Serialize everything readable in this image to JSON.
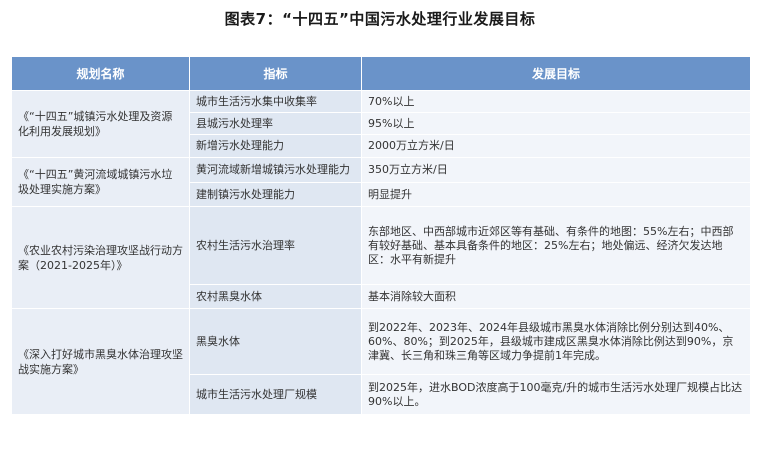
{
  "title": "图表7：“十四五”中国污水处理行业发展目标",
  "headers": [
    "规划名称",
    "指标",
    "发展目标"
  ],
  "groups": [
    {
      "plan": "《“十四五”城镇污水处理及资源化利用发展规划》",
      "rows": [
        {
          "indicator": "城市生活污水集中收集率",
          "goal": "70%以上"
        },
        {
          "indicator": "县城污水处理率",
          "goal": "95%以上"
        },
        {
          "indicator": "新增污水处理能力",
          "goal": "2000万立方米/日"
        }
      ]
    },
    {
      "plan": "《“十四五”黄河流域城镇污水垃圾处理实施方案》",
      "rows": [
        {
          "indicator": "黄河流域新增城镇污水处理能力",
          "goal": "350万立方米/日"
        },
        {
          "indicator": "建制镇污水处理能力",
          "goal": "明显提升"
        }
      ]
    },
    {
      "plan": "《农业农村污染治理攻坚战行动方案（2021-2025年）》",
      "rows": [
        {
          "indicator": "农村生活污水治理率",
          "goal": "东部地区、中西部城市近郊区等有基础、有条件的地图：55%左右；中西部有较好基础、基本具备条件的地区：25%左右；地处偏远、经济欠发达地区：水平有新提升"
        },
        {
          "indicator": "农村黑臭水体",
          "goal": "基本消除较大面积"
        }
      ]
    },
    {
      "plan": "《深入打好城市黑臭水体治理攻坚战实施方案》",
      "rows": [
        {
          "indicator": "黑臭水体",
          "goal": "到2022年、2023年、2024年县级城市黑臭水体消除比例分别达到40%、60%、80%；到2025年，县级城市建成区黑臭水体消除比例达到90%，京津冀、长三角和珠三角等区域力争提前1年完成。"
        },
        {
          "indicator": "城市生活污水处理厂规模",
          "goal": "到2025年，进水BOD浓度高于100毫克/升的城市生活污水处理厂规模占比达90%以上。"
        }
      ]
    }
  ]
}
